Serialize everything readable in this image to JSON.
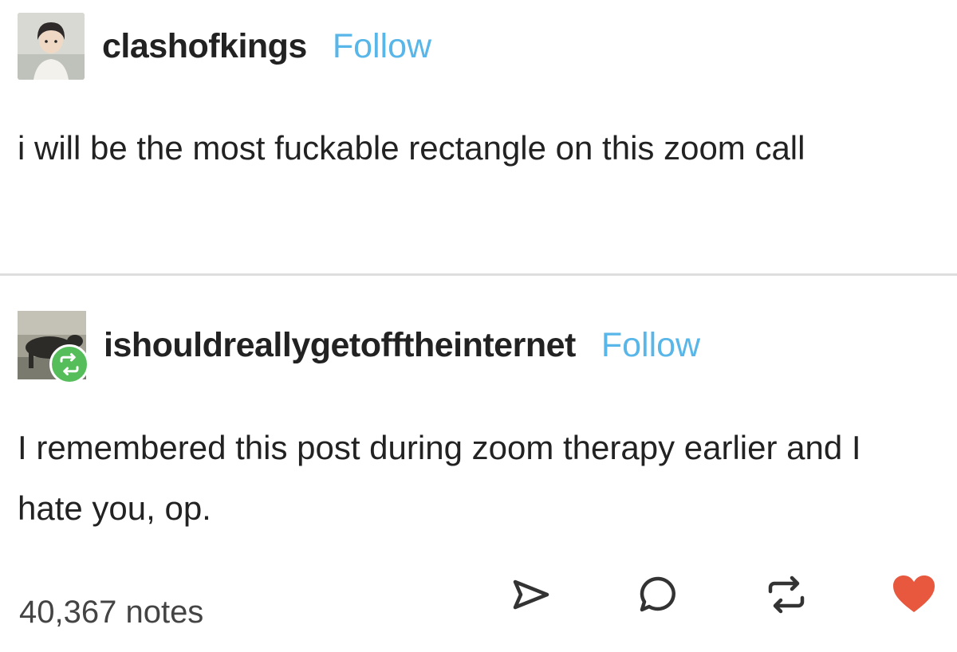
{
  "posts": [
    {
      "username": "clashofkings",
      "follow_label": "Follow",
      "body": "i will be the most fuckable rectangle on this zoom call"
    },
    {
      "username": "ishouldreallygetofftheinternet",
      "follow_label": "Follow",
      "body": "I remembered this post during zoom therapy earlier and I hate you, op.",
      "badge_icon": "reblog-icon"
    }
  ],
  "footer": {
    "notes": "40,367 notes",
    "actions": [
      "share-icon",
      "reply-icon",
      "reblog-icon",
      "like-icon"
    ]
  },
  "colors": {
    "follow": "#58b6e8",
    "reblog_badge": "#56bd5b",
    "like": "#e8583e",
    "text": "#222222"
  }
}
